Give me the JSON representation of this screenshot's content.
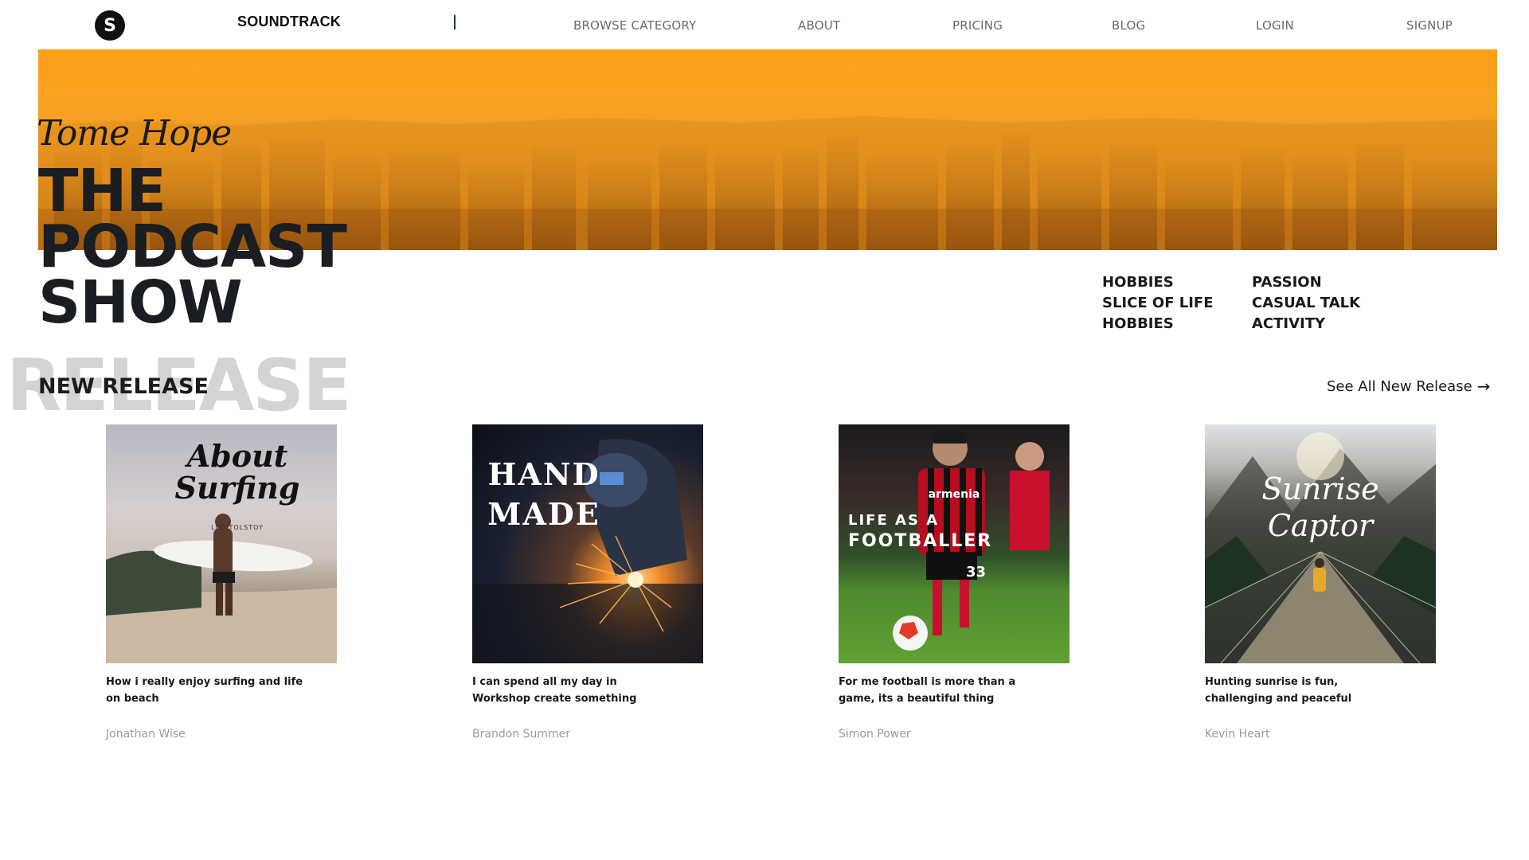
{
  "nav": {
    "logo_letter": "S",
    "brand": "SOUNDTRACK",
    "links": [
      "BROWSE CATEGORY",
      "ABOUT",
      "PRICING",
      "BLOG",
      "LOGIN",
      "SIGNUP"
    ]
  },
  "hero": {
    "script_title": "Tome Hope",
    "title_lines": [
      "THE",
      "PODCAST",
      "SHOW"
    ],
    "tags_col1": [
      "HOBBIES",
      "SLICE OF LIFE",
      "HOBBIES"
    ],
    "tags_col2": [
      "PASSION",
      "CASUAL TALK",
      "ACTIVITY"
    ]
  },
  "new_release": {
    "ghost_text": "RELEASE",
    "title": "NEW RELEASE",
    "see_all": "See All New Release",
    "arrow_icon": "→",
    "cards": [
      {
        "cover_title_lines": [
          "About",
          "Surfing"
        ],
        "cover_sub": "LEO TOLSTOY",
        "desc": "How i really enjoy surfing and life on beach",
        "author": "Jonathan Wise"
      },
      {
        "cover_title_lines": [
          "HAND",
          "MADE"
        ],
        "desc": "I can spend all my day in Workshop create something",
        "author": "Brandon Summer"
      },
      {
        "cover_title_lines": [
          "LIFE AS A",
          "FOOTBALLER"
        ],
        "cover_jersey": "armenia",
        "cover_number": "33",
        "desc": "For me football is more than a game, its a beautiful thing",
        "author": "Simon Power"
      },
      {
        "cover_title_lines": [
          "Sunrise",
          "Captor"
        ],
        "desc": "Hunting sunrise is fun, challenging and peaceful",
        "author": "Kevin Heart"
      }
    ]
  },
  "colors": {
    "hero_orange": "#f7a223",
    "text_dark": "#1a1d22",
    "nav_link": "#6a6a6a",
    "muted_author": "#9a9a9a",
    "ghost": "#d4d4d4"
  }
}
